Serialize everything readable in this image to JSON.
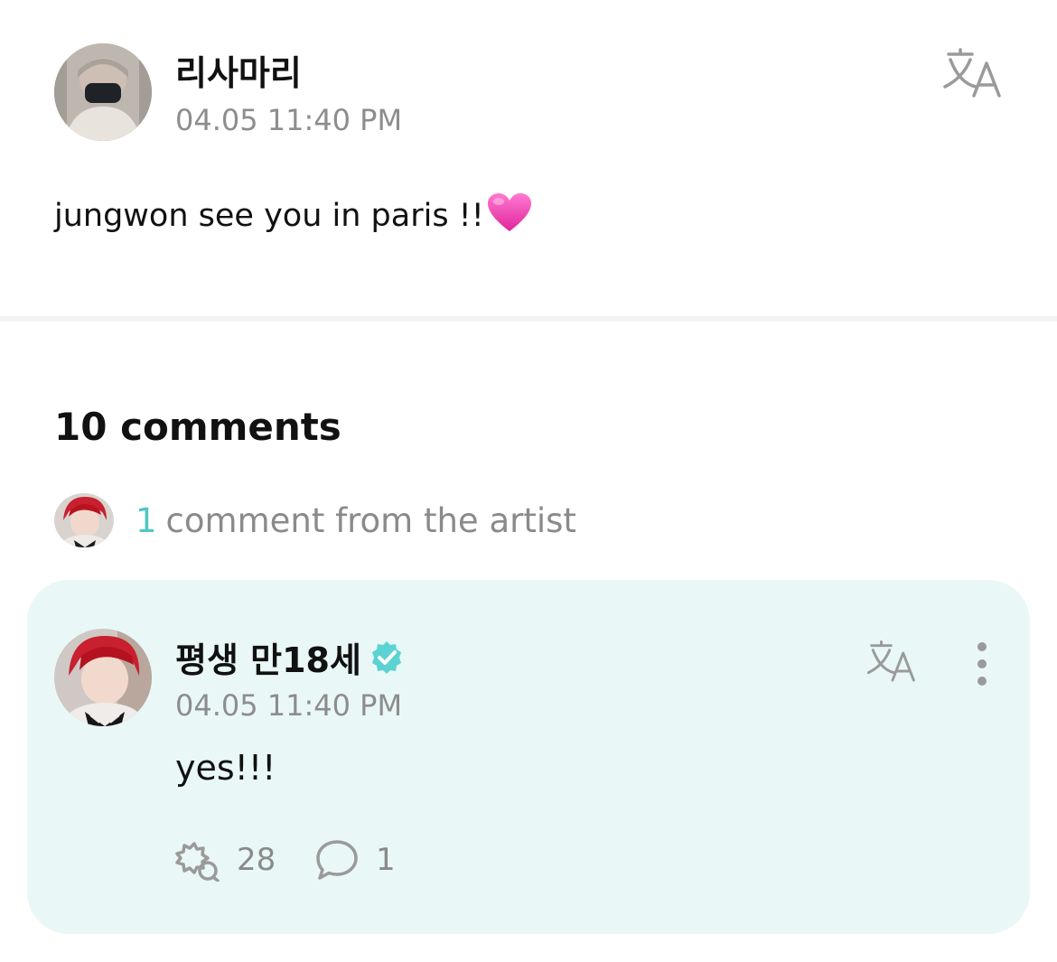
{
  "post": {
    "author": "리사마리",
    "timestamp": "04.05 11:40 PM",
    "text": "jungwon see you in paris !!",
    "emoji": "pink-heart"
  },
  "comments": {
    "count_label": "10 comments",
    "artist_summary": {
      "count": "1",
      "label": "comment from the artist"
    }
  },
  "artist_comment": {
    "author": "평생 만18세",
    "verified": true,
    "timestamp": "04.05 11:40 PM",
    "text": "yes!!!",
    "reaction_count": "28",
    "reply_count": "1"
  },
  "icons": {
    "translate": "translate-icon",
    "more": "more-vertical-icon",
    "reaction": "reaction-icon",
    "reply": "reply-bubble-icon",
    "verified": "verified-badge-icon"
  },
  "colors": {
    "accent": "#4fc7c4",
    "card_background": "#e9f8f6",
    "muted_text": "#8d8d8d",
    "icon_gray": "#9a9a9a"
  }
}
